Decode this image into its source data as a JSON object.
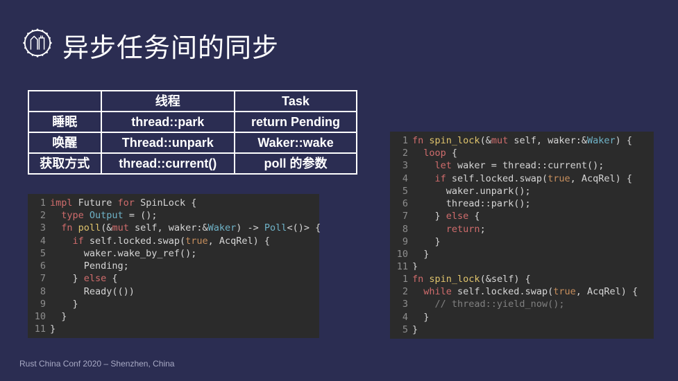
{
  "title": "异步任务间的同步",
  "footer": "Rust China Conf 2020 – Shenzhen, China",
  "table": {
    "headers": [
      "",
      "线程",
      "Task"
    ],
    "rows": [
      [
        "睡眠",
        "thread::park",
        "return Pending"
      ],
      [
        "唤醒",
        "Thread::unpark",
        "Waker::wake"
      ],
      [
        "获取方式",
        "thread::current()",
        "poll 的参数"
      ]
    ]
  },
  "code1": [
    [
      {
        "c": "kw",
        "t": "impl"
      },
      {
        "c": "plain",
        "t": " Future "
      },
      {
        "c": "kw",
        "t": "for"
      },
      {
        "c": "plain",
        "t": " SpinLock {"
      }
    ],
    [
      {
        "c": "plain",
        "t": "  "
      },
      {
        "c": "kw",
        "t": "type"
      },
      {
        "c": "plain",
        "t": " "
      },
      {
        "c": "ty",
        "t": "Output"
      },
      {
        "c": "plain",
        "t": " = ();"
      }
    ],
    [
      {
        "c": "plain",
        "t": "  "
      },
      {
        "c": "kw",
        "t": "fn"
      },
      {
        "c": "plain",
        "t": " "
      },
      {
        "c": "fnname",
        "t": "poll"
      },
      {
        "c": "plain",
        "t": "(&"
      },
      {
        "c": "kw",
        "t": "mut"
      },
      {
        "c": "plain",
        "t": " self, waker:&"
      },
      {
        "c": "ty",
        "t": "Waker"
      },
      {
        "c": "plain",
        "t": ") -> "
      },
      {
        "c": "ty",
        "t": "Poll"
      },
      {
        "c": "plain",
        "t": "<()> {"
      }
    ],
    [
      {
        "c": "plain",
        "t": "    "
      },
      {
        "c": "kw",
        "t": "if"
      },
      {
        "c": "plain",
        "t": " self.locked.swap("
      },
      {
        "c": "bool",
        "t": "true"
      },
      {
        "c": "plain",
        "t": ", AcqRel) {"
      }
    ],
    [
      {
        "c": "plain",
        "t": "      waker.wake_by_ref();"
      }
    ],
    [
      {
        "c": "plain",
        "t": "      Pending;"
      }
    ],
    [
      {
        "c": "plain",
        "t": "    } "
      },
      {
        "c": "kw",
        "t": "else"
      },
      {
        "c": "plain",
        "t": " {"
      }
    ],
    [
      {
        "c": "plain",
        "t": "      Ready(())"
      }
    ],
    [
      {
        "c": "plain",
        "t": "    }"
      }
    ],
    [
      {
        "c": "plain",
        "t": "  }"
      }
    ],
    [
      {
        "c": "plain",
        "t": "}"
      }
    ]
  ],
  "code2": [
    [
      {
        "c": "kw",
        "t": "fn"
      },
      {
        "c": "plain",
        "t": " "
      },
      {
        "c": "fnname",
        "t": "spin_lock"
      },
      {
        "c": "plain",
        "t": "(&"
      },
      {
        "c": "kw",
        "t": "mut"
      },
      {
        "c": "plain",
        "t": " self, waker:&"
      },
      {
        "c": "ty",
        "t": "Waker"
      },
      {
        "c": "plain",
        "t": ") {"
      }
    ],
    [
      {
        "c": "plain",
        "t": "  "
      },
      {
        "c": "kw",
        "t": "loop"
      },
      {
        "c": "plain",
        "t": " {"
      }
    ],
    [
      {
        "c": "plain",
        "t": "    "
      },
      {
        "c": "kw",
        "t": "let"
      },
      {
        "c": "plain",
        "t": " waker = thread::current();"
      }
    ],
    [
      {
        "c": "plain",
        "t": "    "
      },
      {
        "c": "kw",
        "t": "if"
      },
      {
        "c": "plain",
        "t": " self.locked.swap("
      },
      {
        "c": "bool",
        "t": "true"
      },
      {
        "c": "plain",
        "t": ", AcqRel) {"
      }
    ],
    [
      {
        "c": "plain",
        "t": "      waker.unpark();"
      }
    ],
    [
      {
        "c": "plain",
        "t": "      thread::park();"
      }
    ],
    [
      {
        "c": "plain",
        "t": "    } "
      },
      {
        "c": "kw",
        "t": "else"
      },
      {
        "c": "plain",
        "t": " {"
      }
    ],
    [
      {
        "c": "plain",
        "t": "      "
      },
      {
        "c": "kw",
        "t": "return"
      },
      {
        "c": "plain",
        "t": ";"
      }
    ],
    [
      {
        "c": "plain",
        "t": "    }"
      }
    ],
    [
      {
        "c": "plain",
        "t": "  }"
      }
    ],
    [
      {
        "c": "plain",
        "t": "}"
      }
    ]
  ],
  "code3": [
    [
      {
        "c": "kw",
        "t": "fn"
      },
      {
        "c": "plain",
        "t": " "
      },
      {
        "c": "fnname",
        "t": "spin_lock"
      },
      {
        "c": "plain",
        "t": "(&self) {"
      }
    ],
    [
      {
        "c": "plain",
        "t": "  "
      },
      {
        "c": "kw",
        "t": "while"
      },
      {
        "c": "plain",
        "t": " self.locked.swap("
      },
      {
        "c": "bool",
        "t": "true"
      },
      {
        "c": "plain",
        "t": ", AcqRel) {"
      }
    ],
    [
      {
        "c": "plain",
        "t": "    "
      },
      {
        "c": "comment",
        "t": "// thread::yield_now();"
      }
    ],
    [
      {
        "c": "plain",
        "t": "  }"
      }
    ],
    [
      {
        "c": "plain",
        "t": "}"
      }
    ]
  ]
}
